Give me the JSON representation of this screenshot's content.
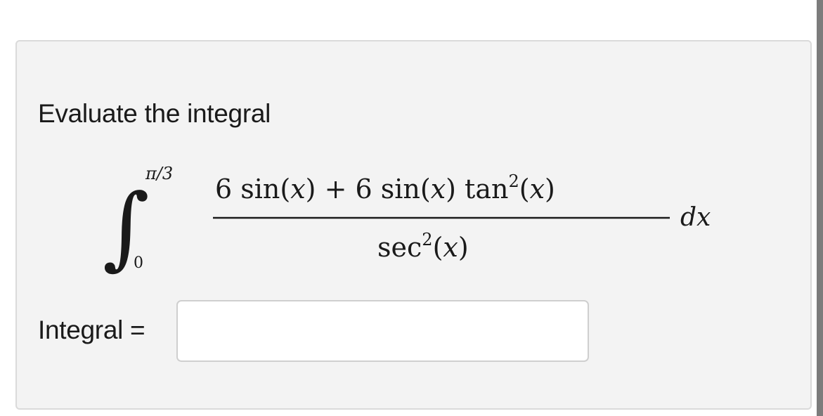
{
  "problem": {
    "prompt": "Evaluate the integral",
    "integral": {
      "symbol": "∫",
      "upper_limit": "π/3",
      "lower_limit": "0",
      "numerator_parts": [
        "6",
        " sin(",
        "x",
        ") + 6",
        " sin(",
        "x",
        ") tan",
        "2",
        "(",
        "x",
        ")"
      ],
      "denominator_parts": [
        "sec",
        "2",
        "(",
        "x",
        ")"
      ],
      "differential": "dx"
    }
  },
  "answer": {
    "label": "Integral =",
    "value": "",
    "placeholder": ""
  },
  "colors": {
    "card_background": "#f3f3f3",
    "card_border": "#dadada",
    "text": "#1a1a1a",
    "right_bar": "#7c7c7c"
  }
}
